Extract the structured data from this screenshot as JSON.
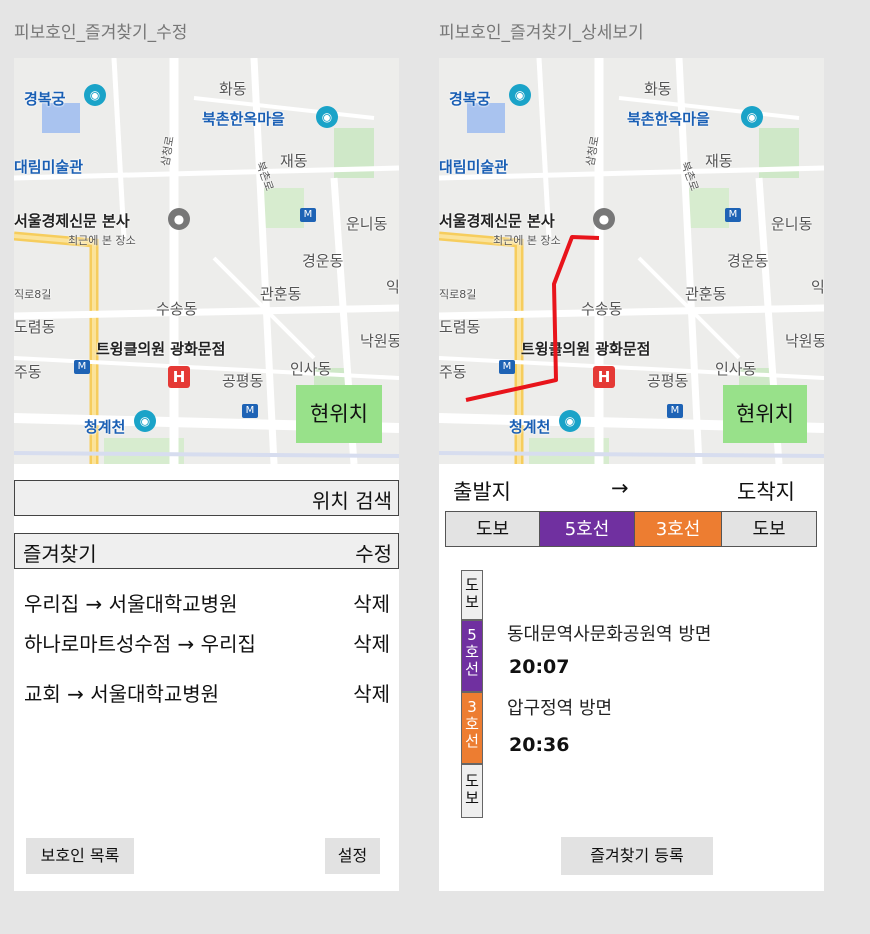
{
  "screens": {
    "edit": {
      "title": "피보호인_즐겨찾기_수정",
      "location_button": "현위치",
      "search_label": "위치 검색",
      "favorites_header": {
        "label": "즐겨찾기",
        "edit": "수정"
      },
      "favorites": [
        {
          "route": "우리집 → 서울대학교병원",
          "delete": "삭제"
        },
        {
          "route": "하나로마트성수점 → 우리집",
          "delete": "삭제"
        },
        {
          "route": "교회 → 서울대학교병원",
          "delete": "삭제"
        }
      ],
      "footer": {
        "left": "보호인 목록",
        "right": "설정"
      }
    },
    "detail": {
      "title": "피보호인_즐겨찾기_상세보기",
      "location_button": "현위치",
      "route_header": {
        "origin": "출발지",
        "arrow": "→",
        "destination": "도착지"
      },
      "segments": [
        {
          "label": "도보",
          "color": "#e3e3e3",
          "text_color": "#111"
        },
        {
          "label": "5호선",
          "color": "#7030a0",
          "text_color": "#ffffff"
        },
        {
          "label": "3호선",
          "color": "#ed7d31",
          "text_color": "#ffffff"
        },
        {
          "label": "도보",
          "color": "#e3e3e3",
          "text_color": "#111"
        }
      ],
      "vertical_segments": [
        {
          "label": "도\n보"
        },
        {
          "label": "5\n호\n선"
        },
        {
          "label": "3\n호\n선"
        },
        {
          "label": "도\n보"
        }
      ],
      "stops": [
        {
          "direction": "동대문역사문화공원역 방면",
          "time": "20:07"
        },
        {
          "direction": "압구정역 방면",
          "time": "20:36"
        }
      ],
      "register_button": "즐겨찾기 등록"
    }
  },
  "map_labels": {
    "gyeongbokgung": "경복궁",
    "hwadong": "화동",
    "bukchon": "북촌한옥마을",
    "daelim": "대림미술관",
    "jaedong": "재동",
    "samcheong": "삼청로",
    "bukchon_ro": "북촌로",
    "newspaper": "서울경제신문 본사",
    "recent": "최근에 본 장소",
    "unni": "운니동",
    "gyeongun": "경운동",
    "road8": "직로8길",
    "susong": "수송동",
    "gwanhun": "관훈동",
    "doryeom": "도렴동",
    "clinic": "트윙클의원 광화문점",
    "nagwon": "낙원동",
    "judong": "주동",
    "gongpyeong": "공평동",
    "insa": "인사동",
    "cheonggye": "청계천",
    "ik": "익"
  },
  "colors": {
    "location_button": "#98e18a",
    "route_line": "#e8141b",
    "line5": "#7030a0",
    "line3": "#ed7d31"
  }
}
